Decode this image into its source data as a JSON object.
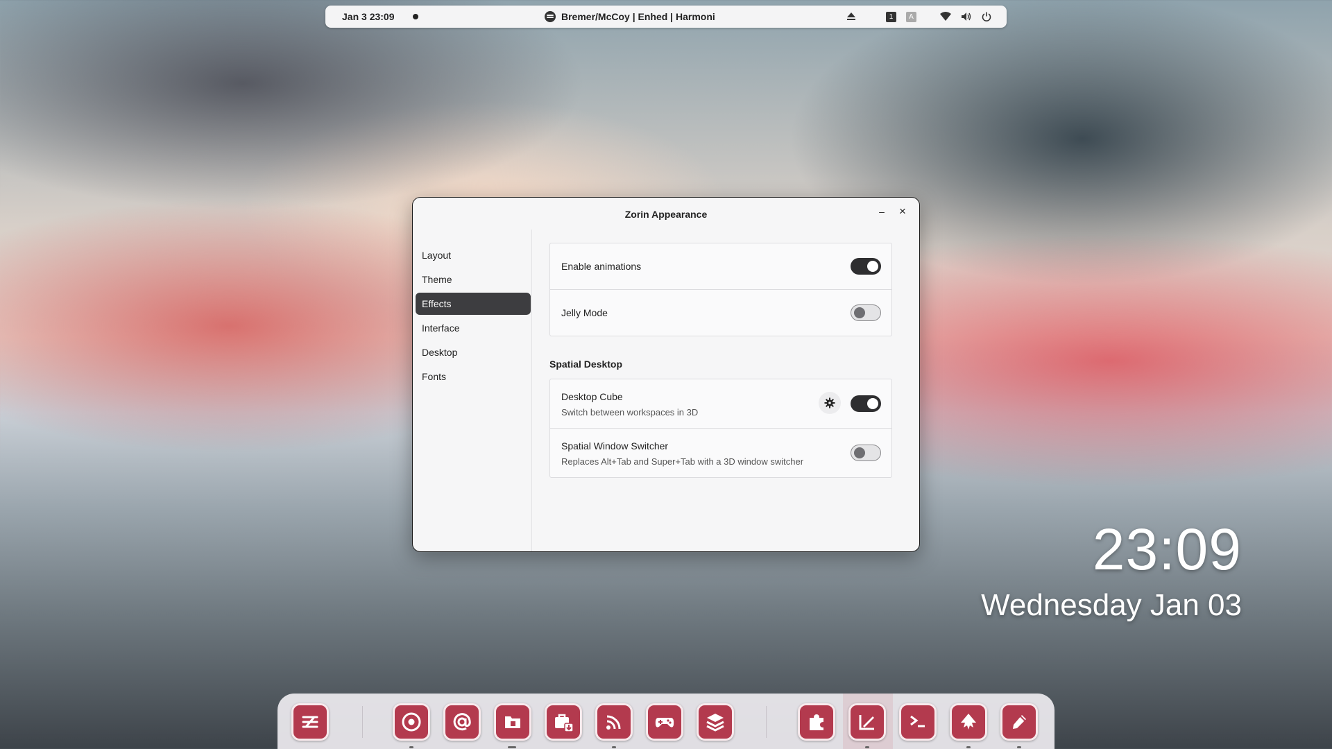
{
  "topbar": {
    "date": "Jan 3  23:09",
    "media_title": "Bremer/McCoy | Enhed | Harmoni",
    "keyboard_a": "1",
    "keyboard_b": "A"
  },
  "window": {
    "title": "Zorin Appearance",
    "minimize": "–",
    "close": "×"
  },
  "sidebar": {
    "items": [
      {
        "label": "Layout"
      },
      {
        "label": "Theme"
      },
      {
        "label": "Effects"
      },
      {
        "label": "Interface"
      },
      {
        "label": "Desktop"
      },
      {
        "label": "Fonts"
      }
    ],
    "active": "Effects"
  },
  "effects": {
    "enable_animations": {
      "label": "Enable animations",
      "on": true
    },
    "jelly_mode": {
      "label": "Jelly Mode",
      "on": false
    },
    "section_title": "Spatial Desktop",
    "desktop_cube": {
      "label": "Desktop Cube",
      "description": "Switch between workspaces in 3D",
      "on": true
    },
    "spatial_switcher": {
      "label": "Spatial Window Switcher",
      "description": "Replaces Alt+Tab and Super+Tab with a 3D window switcher",
      "on": false
    }
  },
  "desktop": {
    "time": "23:09",
    "date": "Wednesday Jan 03"
  },
  "dock": {
    "accent": "#b33a4e",
    "apps": [
      "zorin-menu-icon",
      "chrome-icon",
      "mail-icon",
      "files-icon",
      "software-store-icon",
      "rss-reader-icon",
      "games-icon",
      "layers-icon",
      "extensions-icon",
      "drawing-icon",
      "terminal-icon",
      "inkscape-icon",
      "color-picker-icon"
    ]
  }
}
